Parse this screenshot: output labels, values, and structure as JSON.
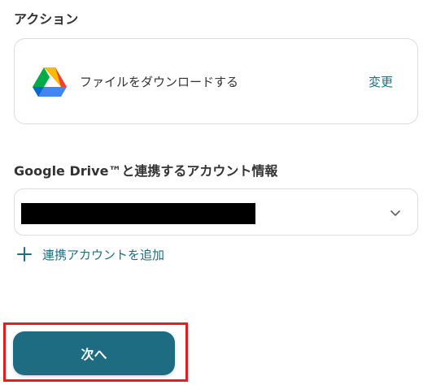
{
  "action_section": {
    "title": "アクション",
    "action_label": "ファイルをダウンロードする",
    "action_icon": "google-drive-icon",
    "change_label": "変更"
  },
  "account_section": {
    "title": "Google Drive™と連携するアカウント情報",
    "select_value_redacted": true,
    "add_account_label": "連携アカウントを追加"
  },
  "footer": {
    "next_label": "次へ"
  },
  "colors": {
    "accent": "#1e6c82",
    "link": "#1f6e83",
    "highlight": "#e02020",
    "border": "#dcdcdc"
  }
}
